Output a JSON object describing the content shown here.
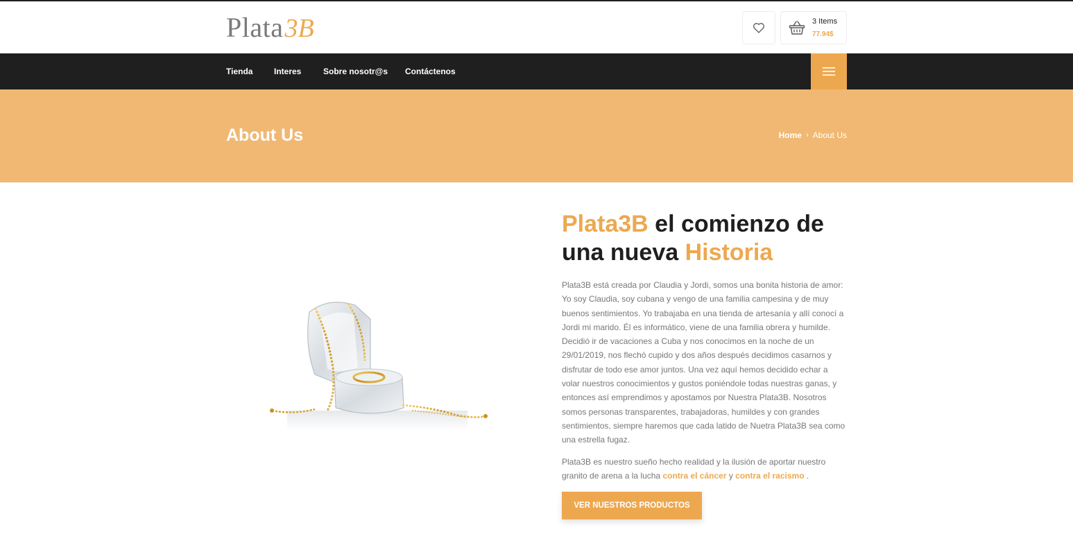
{
  "header": {
    "logo": {
      "word": "Plata",
      "mark": "3B"
    },
    "wishlist": {
      "icon": "heart-icon"
    },
    "cart": {
      "icon": "basket-icon",
      "count_label": "3 Items",
      "total": "77.94$"
    }
  },
  "nav": {
    "items": [
      {
        "label": "Tienda"
      },
      {
        "label": "Interes"
      },
      {
        "label": "Sobre nosotr@s"
      },
      {
        "label": "Contáctenos"
      }
    ],
    "menu_icon": "hamburger-icon"
  },
  "banner": {
    "title": "About Us",
    "breadcrumb": {
      "home": "Home",
      "separator": "›",
      "current": "About Us"
    }
  },
  "content": {
    "headline": {
      "part1_accent": "Plata3B",
      "part2": " el comienzo de una nueva ",
      "part3_accent": "Historia"
    },
    "paragraph1": "Plata3B está creada por Claudia y Jordi, somos una bonita historia de amor: Yo soy Claudia, soy cubana y vengo de una familia campesina y de muy buenos sentimientos. Yo trabajaba en una tienda de artesanía y allí conocí a Jordi mi marido. Él es informático, viene de una familia obrera y humilde. Decidió ir de vacaciones a Cuba y nos conocimos en la noche de un 29/01/2019, nos flechó cupido y dos años después decidimos casarnos y disfrutar de todo ese amor juntos. Una vez aquí hemos decidido echar a volar nuestros conocimientos y gustos poniéndole todas nuestras ganas, y entonces así emprendimos y apostamos por Nuestra Plata3B. Nosotros somos personas transparentes, trabajadoras, humildes y con grandes sentimientos, siempre haremos que cada latido de Nuetra Plata3B sea como una estrella fugaz.",
    "paragraph2": {
      "text": "Plata3B es nuestro sueño hecho realidad y la ilusión de aportar nuestro granito de arena a la lucha ",
      "link1": "contra el cáncer",
      "middle": " y ",
      "link2": "contra el racismo",
      "end": " ."
    },
    "cta_label": "VER NUESTROS PRODUCTOS",
    "image": {
      "subject": "jewelry-ring-box-image"
    }
  },
  "colors": {
    "accent": "#eda84f",
    "banner": "#f0b872",
    "nav_bg": "#1f1f1f",
    "text": "#777777"
  }
}
